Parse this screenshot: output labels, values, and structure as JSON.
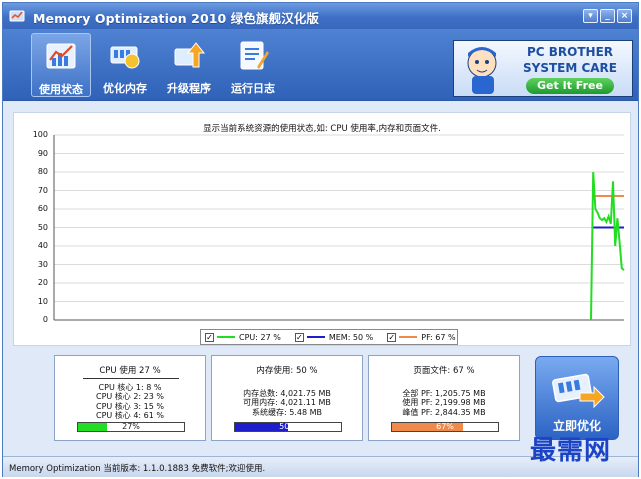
{
  "window": {
    "title": "Memory Optimization 2010 绿色旗舰汉化版",
    "controls": {
      "help": "▾",
      "minimize": "_",
      "close": "×"
    }
  },
  "toolbar": {
    "items": [
      {
        "label": "使用状态",
        "icon": "chart-icon",
        "active": true
      },
      {
        "label": "优化内存",
        "icon": "memory-optimize-icon",
        "active": false
      },
      {
        "label": "升级程序",
        "icon": "upgrade-icon",
        "active": false
      },
      {
        "label": "运行日志",
        "icon": "log-icon",
        "active": false
      }
    ]
  },
  "banner": {
    "line1": "PC BROTHER",
    "line2": "SYSTEM CARE",
    "button": "Get It Free"
  },
  "chart_data": {
    "type": "line",
    "title": "显示当前系统资源的使用状态,如: CPU 使用率,内存和页面文件.",
    "ylim": [
      0,
      100
    ],
    "yticks": [
      "100",
      "90",
      "80",
      "70",
      "60",
      "50",
      "40",
      "30",
      "20",
      "10",
      "0"
    ],
    "grid": true,
    "x": [
      0,
      1,
      2,
      3,
      4,
      5,
      6,
      7,
      8,
      9,
      10,
      11,
      12,
      13,
      14,
      15
    ],
    "series": [
      {
        "name": "CPU",
        "color": "#22dd22",
        "values": [
          0,
          80,
          60,
          58,
          55,
          54,
          55,
          53,
          56,
          52,
          75,
          40,
          55,
          42,
          28,
          27
        ]
      },
      {
        "name": "MEM",
        "color": "#1e1ecc",
        "values": [
          null,
          50,
          50,
          50,
          50,
          50,
          50,
          50,
          50,
          50,
          50,
          50,
          50,
          50,
          50,
          50
        ]
      },
      {
        "name": "PF",
        "color": "#f08a4b",
        "values": [
          null,
          67,
          67,
          67,
          67,
          67,
          67,
          67,
          67,
          67,
          67,
          67,
          67,
          67,
          67,
          67
        ]
      }
    ]
  },
  "legend": {
    "cpu": {
      "label": "CPU: 27 %",
      "color": "#22dd22",
      "checked": "✓"
    },
    "mem": {
      "label": "MEM: 50 %",
      "color": "#1e1ecc",
      "checked": "✓"
    },
    "pf": {
      "label": "PF: 67 %",
      "color": "#f08a4b",
      "checked": "✓"
    }
  },
  "stats": {
    "cpu": {
      "head": "CPU 使用 27 %",
      "lines": [
        "CPU 核心 1: 8 %",
        "CPU 核心 2: 23 %",
        "CPU 核心 3: 15 %",
        "CPU 核心 4: 61 %"
      ],
      "bar_text": "27%",
      "bar_fraction": 0.27,
      "bar_color": "#22dd22"
    },
    "mem": {
      "head": "内存使用: 50 %",
      "lines": [
        "内存总数: 4,021.75 MB",
        "可用内存: 4,021.11 MB",
        "系统缓存: 5.48 MB"
      ],
      "bar_text": "50%",
      "bar_fraction": 0.5,
      "bar_color": "#1e1ecc"
    },
    "pf": {
      "head": "页面文件: 67 %",
      "lines": [
        "全部 PF: 1,205.75 MB",
        "使用 PF: 2,199.98 MB",
        "峰值 PF: 2,844.35 MB"
      ],
      "bar_text": "67%",
      "bar_fraction": 0.67,
      "bar_color": "#f08a4b"
    }
  },
  "optimize_button": {
    "label": "立即优化"
  },
  "watermark": "最需网",
  "statusbar": {
    "text": "Memory Optimization 当前版本: 1.1.0.1883 免费软件;欢迎使用."
  }
}
